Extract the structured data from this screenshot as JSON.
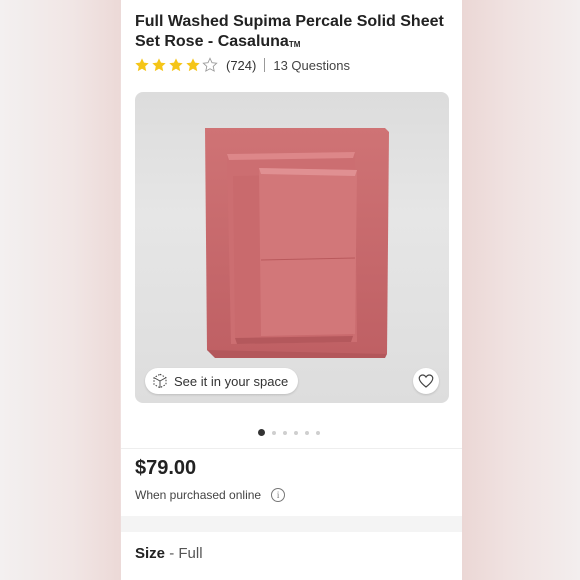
{
  "product": {
    "title": "Full Washed Supima Percale Solid Sheet Set Rose - Casaluna",
    "trademark": "TM",
    "rating": {
      "stars": 4,
      "max": 5,
      "count_text": "(724)"
    },
    "questions_text": "13 Questions",
    "see_in_space_label": "See it in your space",
    "price": "$79.00",
    "price_note": "When purchased online",
    "size_label": "Size",
    "size_separator": "-",
    "size_value": "Full"
  },
  "carousel": {
    "total": 6,
    "active": 1
  },
  "colors": {
    "accent_star": "#f5c518",
    "sheet": "#c7686b",
    "photo_bg": "#e0e0e0"
  },
  "icons": [
    "star-icon",
    "ar-cube-icon",
    "heart-icon",
    "info-icon"
  ]
}
